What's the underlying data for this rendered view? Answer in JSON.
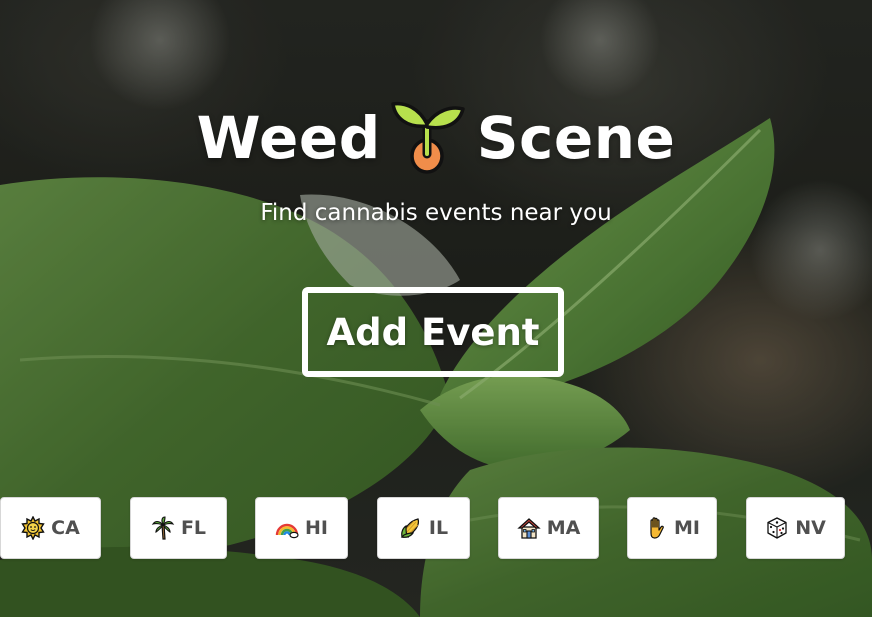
{
  "hero": {
    "background_icon": "cannabis-seedling-photo"
  },
  "title": {
    "word1": "Weed",
    "icon": "seedling-icon",
    "word2": "Scene"
  },
  "subtitle": "Find cannabis events near you",
  "add_event_label": "Add Event",
  "states": [
    {
      "code": "CA",
      "icon": "sun-icon"
    },
    {
      "code": "FL",
      "icon": "palm-tree-icon"
    },
    {
      "code": "HI",
      "icon": "rainbow-icon"
    },
    {
      "code": "IL",
      "icon": "corn-icon"
    },
    {
      "code": "MA",
      "icon": "house-icon"
    },
    {
      "code": "MI",
      "icon": "raised-hand-icon"
    },
    {
      "code": "NV",
      "icon": "dice-icon"
    }
  ],
  "colors": {
    "button_bg": "#ffffff",
    "button_text": "#505050",
    "hero_text": "#ffffff"
  }
}
